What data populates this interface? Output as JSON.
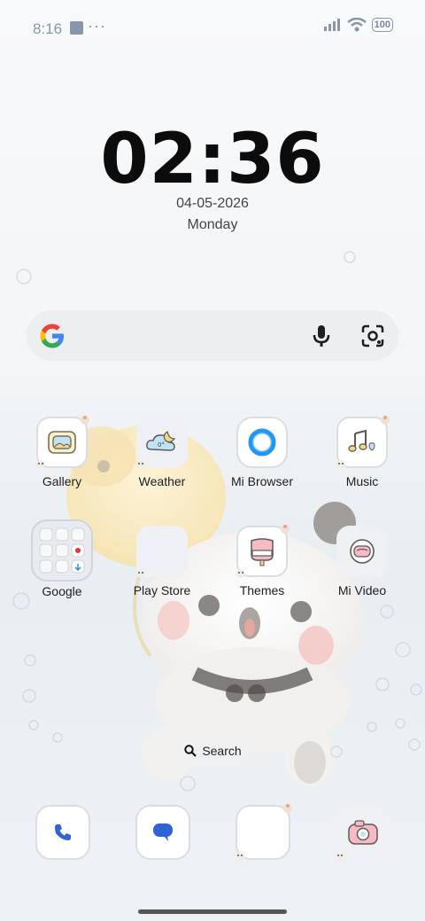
{
  "status_bar": {
    "time": "8:16",
    "more": "···",
    "battery": "100"
  },
  "lockclock": {
    "time": "02:36",
    "date": "04-05-2026",
    "day": "Monday"
  },
  "search_widget": {
    "icons": [
      "google-g-icon",
      "mic-icon",
      "google-lens-icon"
    ]
  },
  "apps_row1": [
    {
      "label": "Gallery",
      "icon": "gallery-icon"
    },
    {
      "label": "Weather",
      "icon": "weather-icon"
    },
    {
      "label": "Mi Browser",
      "icon": "browser-icon"
    },
    {
      "label": "Music",
      "icon": "music-icon"
    }
  ],
  "apps_row2": [
    {
      "label": "Google",
      "icon": "google-folder-icon"
    },
    {
      "label": "Play Store",
      "icon": "play-store-icon"
    },
    {
      "label": "Themes",
      "icon": "themes-icon"
    },
    {
      "label": "Mi Video",
      "icon": "video-icon"
    }
  ],
  "app_search": {
    "label": "Search"
  },
  "dock": [
    {
      "icon": "phone-icon"
    },
    {
      "icon": "messages-icon"
    },
    {
      "icon": "blank-app-icon"
    },
    {
      "icon": "camera-icon"
    }
  ],
  "colors": {
    "accent": "#2f63d6",
    "status": "#8796aa"
  }
}
